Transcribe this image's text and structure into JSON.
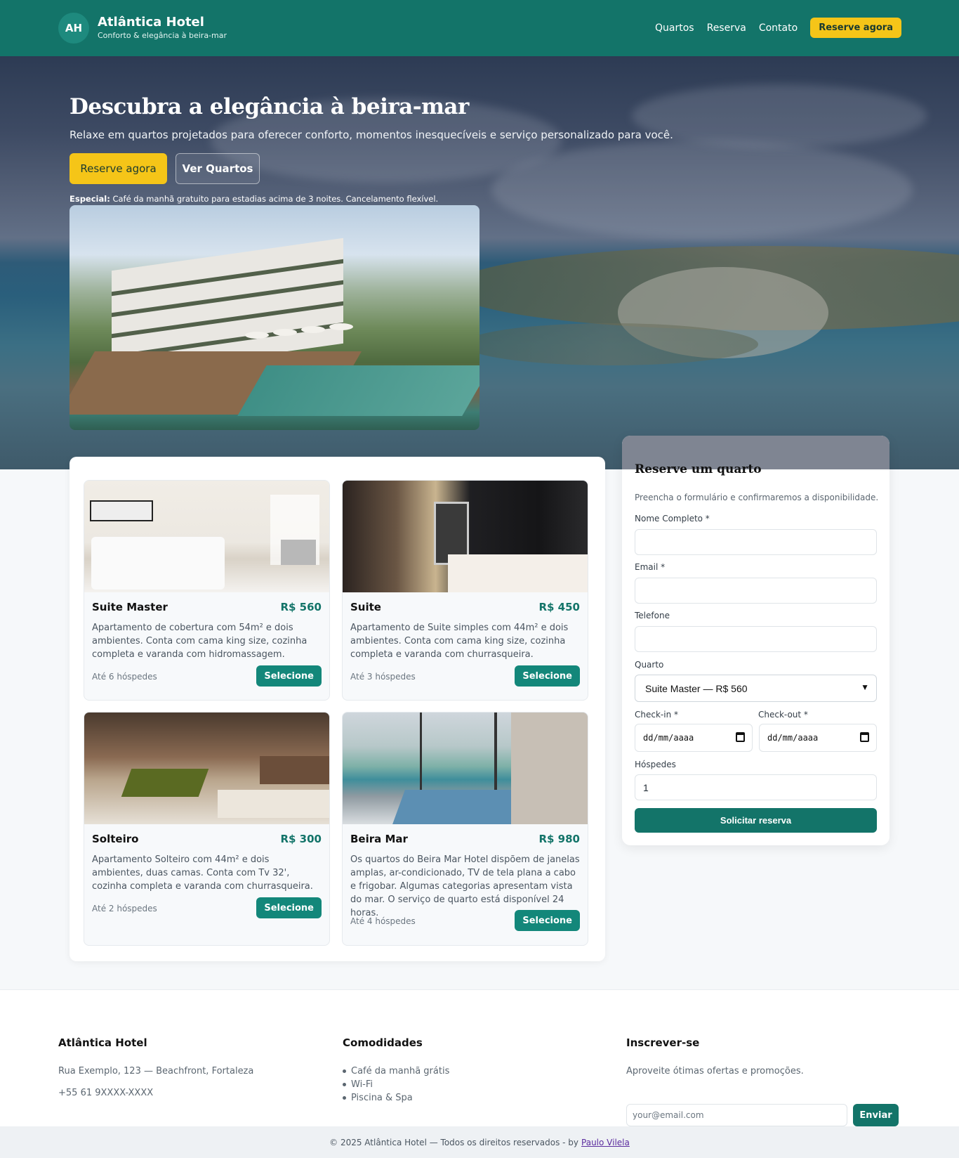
{
  "header": {
    "logo_initials": "AH",
    "brand_name": "Atlântica Hotel",
    "tagline": "Conforto & elegância à beira-mar",
    "nav": [
      "Quartos",
      "Reserva",
      "Contato"
    ],
    "cta": "Reserve agora"
  },
  "hero": {
    "title": "Descubra a elegância à beira-mar",
    "subtitle": "Relaxe em quartos projetados para oferecer conforto, momentos inesquecíveis e serviço personalizado para você.",
    "primary_button": "Reserve agora",
    "secondary_button": "Ver Quartos",
    "special_label": "Especial:",
    "special_text": " Café da manhã gratuito para estadias acima de 3 noites. Cancelamento flexível."
  },
  "rooms": [
    {
      "name": "Suite Master",
      "price": "R$ 560",
      "description": "Apartamento de cobertura com 54m² e dois ambientes. Conta com cama king size, cozinha completa e varanda com hidromassagem.",
      "guests": "Até 6 hóspedes",
      "button": "Selecione"
    },
    {
      "name": "Suite",
      "price": "R$ 450",
      "description": "Apartamento de Suite simples com 44m² e dois ambientes. Conta com cama king size, cozinha completa e varanda com churrasqueira.",
      "guests": "Até 3 hóspedes",
      "button": "Selecione"
    },
    {
      "name": "Solteiro",
      "price": "R$ 300",
      "description": "Apartamento Solteiro com 44m² e dois ambientes, duas camas. Conta com Tv 32', cozinha completa e varanda com churrasqueira.",
      "guests": "Até 2 hóspedes",
      "button": "Selecione"
    },
    {
      "name": "Beira Mar",
      "price": "R$ 980",
      "description": "Os quartos do Beira Mar Hotel dispõem de janelas amplas, ar-condicionado, TV de tela plana a cabo e frigobar. Algumas categorias apresentam vista do mar. O serviço de quarto está disponível 24 horas.",
      "guests": "Até 4 hóspedes",
      "button": "Selecione"
    }
  ],
  "booking": {
    "title": "Reserve um quarto",
    "hint": "Preencha o formulário e confirmaremos a disponibilidade.",
    "name_label": "Nome Completo *",
    "email_label": "Email *",
    "phone_label": "Telefone",
    "room_label": "Quarto",
    "room_value": "Suite Master — R$ 560",
    "checkin_label": "Check-in *",
    "checkout_label": "Check-out *",
    "date_placeholder": "dd/mm/aaaa",
    "guests_label": "Hóspedes",
    "guests_value": "1",
    "submit": "Solicitar reserva"
  },
  "footer": {
    "col1_title": "Atlântica Hotel",
    "address": "Rua Exemplo, 123 — Beachfront, Fortaleza",
    "phone": "+55 61 9XXXX-XXXX",
    "col2_title": "Comodidades",
    "amenities": [
      "Café da manhã grátis",
      "Wi-Fi",
      "Piscina & Spa"
    ],
    "col3_title": "Inscrever-se",
    "newsletter_text": "Aproveite ótimas ofertas e promoções.",
    "email_placeholder": "your@email.com",
    "send": "Enviar",
    "copyright": "© 2025 Atlântica Hotel — Todos os direitos reservados - by",
    "author": "Paulo Vilela"
  },
  "colors": {
    "primary": "#137469",
    "accent": "#f5c518",
    "button": "#13877a"
  }
}
